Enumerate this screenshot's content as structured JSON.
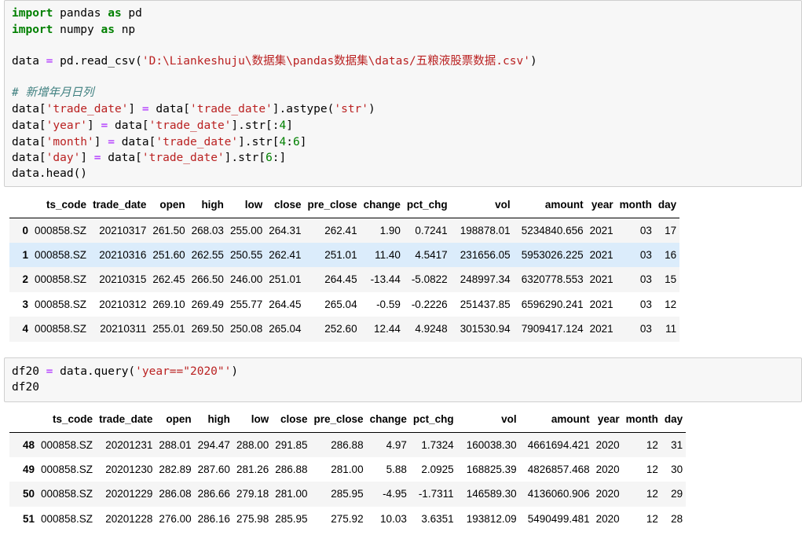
{
  "cell1": {
    "lines": {
      "l1": {
        "kw1": "import",
        "a": " pandas ",
        "kw2": "as",
        "b": " pd"
      },
      "l2": {
        "kw1": "import",
        "a": " numpy ",
        "kw2": "as",
        "b": " np"
      },
      "l3": {
        "a": "data ",
        "op": "=",
        "b": " pd.read_csv(",
        "s": "'D:\\Liankeshuju\\数据集\\pandas数据集\\datas/五粮液股票数据.csv'",
        "c": ")"
      },
      "l4": {
        "comment": "# 新增年月日列"
      },
      "l5": {
        "a": "data[",
        "s1": "'trade_date'",
        "b": "] ",
        "op": "=",
        "c": " data[",
        "s2": "'trade_date'",
        "d": "].astype(",
        "s3": "'str'",
        "e": ")"
      },
      "l6": {
        "a": "data[",
        "s1": "'year'",
        "b": "] ",
        "op": "=",
        "c": " data[",
        "s2": "'trade_date'",
        "d": "].str[:",
        "n1": "4",
        "e": "]"
      },
      "l7": {
        "a": "data[",
        "s1": "'month'",
        "b": "] ",
        "op": "=",
        "c": " data[",
        "s2": "'trade_date'",
        "d": "].str[",
        "n1": "4",
        "e": ":",
        "n2": "6",
        "f": "]"
      },
      "l8": {
        "a": "data[",
        "s1": "'day'",
        "b": "] ",
        "op": "=",
        "c": " data[",
        "s2": "'trade_date'",
        "d": "].str[",
        "n1": "6",
        "e": ":]"
      },
      "l9": {
        "a": "data.head()"
      }
    }
  },
  "table1": {
    "columns": [
      "ts_code",
      "trade_date",
      "open",
      "high",
      "low",
      "close",
      "pre_close",
      "change",
      "pct_chg",
      "vol",
      "amount",
      "year",
      "month",
      "day"
    ],
    "rows": [
      {
        "idx": "0",
        "v": [
          "000858.SZ",
          "20210317",
          "261.50",
          "268.03",
          "255.00",
          "264.31",
          "262.41",
          "1.90",
          "0.7241",
          "198878.01",
          "5234840.656",
          "2021",
          "03",
          "17"
        ]
      },
      {
        "idx": "1",
        "v": [
          "000858.SZ",
          "20210316",
          "251.60",
          "262.55",
          "250.55",
          "262.41",
          "251.01",
          "11.40",
          "4.5417",
          "231656.05",
          "5953026.225",
          "2021",
          "03",
          "16"
        ]
      },
      {
        "idx": "2",
        "v": [
          "000858.SZ",
          "20210315",
          "262.45",
          "266.50",
          "246.00",
          "251.01",
          "264.45",
          "-13.44",
          "-5.0822",
          "248997.34",
          "6320778.553",
          "2021",
          "03",
          "15"
        ]
      },
      {
        "idx": "3",
        "v": [
          "000858.SZ",
          "20210312",
          "269.10",
          "269.49",
          "255.77",
          "264.45",
          "265.04",
          "-0.59",
          "-0.2226",
          "251437.85",
          "6596290.241",
          "2021",
          "03",
          "12"
        ]
      },
      {
        "idx": "4",
        "v": [
          "000858.SZ",
          "20210311",
          "255.01",
          "269.50",
          "250.08",
          "265.04",
          "252.60",
          "12.44",
          "4.9248",
          "301530.94",
          "7909417.124",
          "2021",
          "03",
          "11"
        ]
      }
    ]
  },
  "cell2": {
    "lines": {
      "l1": {
        "a": "df20 ",
        "op": "=",
        "b": " data.query(",
        "s": "'year==\"2020\"'",
        "c": ")"
      },
      "l2": {
        "a": "df20"
      }
    }
  },
  "table2": {
    "columns": [
      "ts_code",
      "trade_date",
      "open",
      "high",
      "low",
      "close",
      "pre_close",
      "change",
      "pct_chg",
      "vol",
      "amount",
      "year",
      "month",
      "day"
    ],
    "rows": [
      {
        "idx": "48",
        "v": [
          "000858.SZ",
          "20201231",
          "288.01",
          "294.47",
          "288.00",
          "291.85",
          "286.88",
          "4.97",
          "1.7324",
          "160038.30",
          "4661694.421",
          "2020",
          "12",
          "31"
        ]
      },
      {
        "idx": "49",
        "v": [
          "000858.SZ",
          "20201230",
          "282.89",
          "287.60",
          "281.26",
          "286.88",
          "281.00",
          "5.88",
          "2.0925",
          "168825.39",
          "4826857.468",
          "2020",
          "12",
          "30"
        ]
      },
      {
        "idx": "50",
        "v": [
          "000858.SZ",
          "20201229",
          "286.08",
          "286.66",
          "279.18",
          "281.00",
          "285.95",
          "-4.95",
          "-1.7311",
          "146589.30",
          "4136060.906",
          "2020",
          "12",
          "29"
        ]
      },
      {
        "idx": "51",
        "v": [
          "000858.SZ",
          "20201228",
          "276.00",
          "286.16",
          "275.98",
          "285.95",
          "275.92",
          "10.03",
          "3.6351",
          "193812.09",
          "5490499.481",
          "2020",
          "12",
          "28"
        ]
      }
    ]
  }
}
